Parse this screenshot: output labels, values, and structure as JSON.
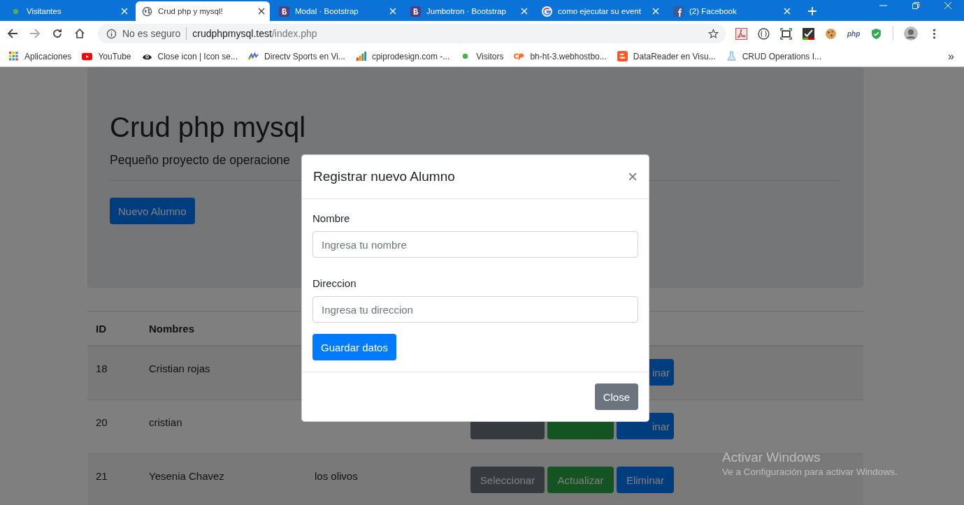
{
  "browser": {
    "tabs": [
      {
        "title": "Visitantes",
        "kind": "dot",
        "selected": false
      },
      {
        "title": "Crud php y mysql!",
        "kind": "globe",
        "selected": true
      },
      {
        "title": "Modal · Bootstrap",
        "kind": "bootstrap",
        "selected": false
      },
      {
        "title": "Jumbotron · Bootstrap",
        "kind": "bootstrap",
        "selected": false
      },
      {
        "title": "como ejecutar su event",
        "kind": "google",
        "selected": false
      },
      {
        "title": "(2) Facebook",
        "kind": "facebook",
        "selected": false
      }
    ],
    "address": {
      "security": "No es seguro",
      "host": "crudphpmysql.test",
      "path": "/index.php"
    },
    "extension_label": "php",
    "bookmarks": [
      {
        "label": "Aplicaciones",
        "kind": "apps"
      },
      {
        "label": "YouTube",
        "kind": "youtube"
      },
      {
        "label": "Close icon | Icon se...",
        "kind": "eye"
      },
      {
        "label": "Directv Sports en Vi...",
        "kind": "wave"
      },
      {
        "label": "cpiprodesign.com -...",
        "kind": "bars"
      },
      {
        "label": "Visitors",
        "kind": "dot"
      },
      {
        "label": "bh-ht-3.webhostbo...",
        "kind": "cpanel"
      },
      {
        "label": "DataReader en Visu...",
        "kind": "blogger"
      },
      {
        "label": "CRUD Operations I...",
        "kind": "flask"
      }
    ],
    "more": "»"
  },
  "page": {
    "jumbotron": {
      "title": "Crud php mysql",
      "lead": "Pequeño proyecto de operacione",
      "button": "Nuevo Alumno"
    },
    "table": {
      "columns": [
        "ID",
        "Nombres"
      ],
      "rows": [
        {
          "id": "18",
          "name": "Cristian rojas",
          "actions": [
            {
              "kind": "danger",
              "label": "inar"
            }
          ]
        },
        {
          "id": "20",
          "name": "cristian",
          "actions": [
            {
              "kind": "secondary"
            },
            {
              "kind": "success"
            },
            {
              "kind": "danger",
              "label": "inar"
            }
          ]
        },
        {
          "id": "21",
          "name": "Yesenia Chavez",
          "address": "los olivos",
          "actions": [
            {
              "kind": "secondary",
              "label": "Seleccionar"
            },
            {
              "kind": "success",
              "label": "Actualizar"
            },
            {
              "kind": "danger",
              "label": "Eliminar"
            }
          ]
        }
      ]
    }
  },
  "modal": {
    "title": "Registrar nuevo Alumno",
    "close": "×",
    "fields": [
      {
        "label": "Nombre",
        "placeholder": "Ingresa tu nombre"
      },
      {
        "label": "Direccion",
        "placeholder": "Ingresa tu direccion"
      }
    ],
    "submit": "Guardar datos",
    "footer_button": "Close"
  },
  "os_watermark": {
    "title": "Activar Windows",
    "text": "Ve a Configuración para activar Windows."
  }
}
